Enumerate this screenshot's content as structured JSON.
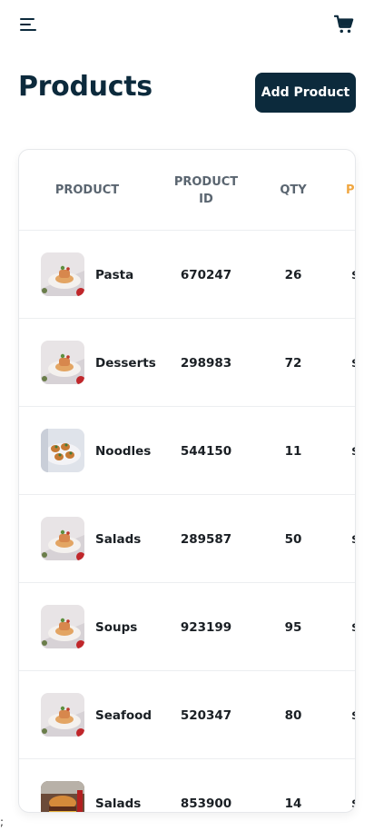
{
  "header": {
    "menu_icon": "hamburger-menu-icon",
    "cart_icon": "shopping-cart-icon"
  },
  "page": {
    "title": "Products",
    "add_button_label": "Add Product"
  },
  "table": {
    "columns": [
      "PRODUCT",
      "PRODUCT\nID",
      "QTY",
      "P"
    ],
    "rows": [
      {
        "name": "Pasta",
        "product_id": "670247",
        "qty": "26",
        "price": "$"
      },
      {
        "name": "Desserts",
        "product_id": "298983",
        "qty": "72",
        "price": "$"
      },
      {
        "name": "Noodles",
        "product_id": "544150",
        "qty": "11",
        "price": "$"
      },
      {
        "name": "Salads",
        "product_id": "289587",
        "qty": "50",
        "price": "$"
      },
      {
        "name": "Soups",
        "product_id": "923199",
        "qty": "95",
        "price": "$"
      },
      {
        "name": "Seafood",
        "product_id": "520347",
        "qty": "80",
        "price": "$"
      },
      {
        "name": "Salads",
        "product_id": "853900",
        "qty": "14",
        "price": "$"
      }
    ]
  },
  "footer": {
    "stray_text": ";"
  },
  "colors": {
    "brand": "#0c2a3c",
    "accent": "#f0a640",
    "border": "#eceef0"
  }
}
